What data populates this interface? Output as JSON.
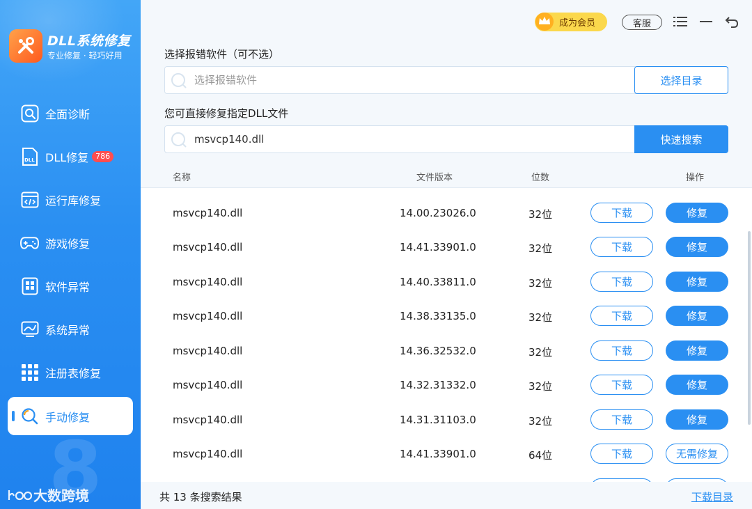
{
  "brand": {
    "title": "DLL系统修复",
    "subtitle": "专业修复 · 轻巧好用"
  },
  "sidebar": {
    "items": [
      {
        "label": "全面诊断",
        "icon": "search-icon"
      },
      {
        "label": "DLL修复",
        "icon": "dll-file-icon",
        "badge": "786"
      },
      {
        "label": "运行库修复",
        "icon": "code-window-icon"
      },
      {
        "label": "游戏修复",
        "icon": "gamepad-icon"
      },
      {
        "label": "软件异常",
        "icon": "app-grid-icon"
      },
      {
        "label": "系统异常",
        "icon": "chart-monitor-icon"
      },
      {
        "label": "注册表修复",
        "icon": "dots-grid-icon"
      },
      {
        "label": "手动修复",
        "icon": "magnify-refresh-icon",
        "active": true
      }
    ],
    "watermark": "大数跨境"
  },
  "topbar": {
    "vip_label": "成为会员",
    "service_label": "客服"
  },
  "main": {
    "select_label": "选择报错软件（可不选）",
    "select_placeholder": "选择报错软件",
    "select_button": "选择目录",
    "dll_label": "您可直接修复指定DLL文件",
    "dll_value": "msvcp140.dll",
    "search_button": "快速搜索"
  },
  "table": {
    "headers": {
      "name": "名称",
      "version": "文件版本",
      "bits": "位数",
      "action": "操作"
    },
    "rows": [
      {
        "name": "msvcp140.dll",
        "version": "14.00.23026.0",
        "bits": "32位",
        "download": "下载",
        "fix": "修复"
      },
      {
        "name": "msvcp140.dll",
        "version": "14.41.33901.0",
        "bits": "32位",
        "download": "下载",
        "fix": "修复"
      },
      {
        "name": "msvcp140.dll",
        "version": "14.40.33811.0",
        "bits": "32位",
        "download": "下载",
        "fix": "修复"
      },
      {
        "name": "msvcp140.dll",
        "version": "14.38.33135.0",
        "bits": "32位",
        "download": "下载",
        "fix": "修复"
      },
      {
        "name": "msvcp140.dll",
        "version": "14.36.32532.0",
        "bits": "32位",
        "download": "下载",
        "fix": "修复"
      },
      {
        "name": "msvcp140.dll",
        "version": "14.32.31332.0",
        "bits": "32位",
        "download": "下载",
        "fix": "修复"
      },
      {
        "name": "msvcp140.dll",
        "version": "14.31.31103.0",
        "bits": "32位",
        "download": "下载",
        "fix": "修复"
      },
      {
        "name": "msvcp140.dll",
        "version": "14.41.33901.0",
        "bits": "64位",
        "download": "下载",
        "fix": "无需修复"
      }
    ]
  },
  "footer": {
    "result_count": "共 13 条搜索结果",
    "download_dir": "下载目录"
  },
  "colors": {
    "primary": "#2a8ff2",
    "vip": "#fbd84c",
    "badge": "#ff4d4f",
    "logo": "#ff6a26"
  }
}
